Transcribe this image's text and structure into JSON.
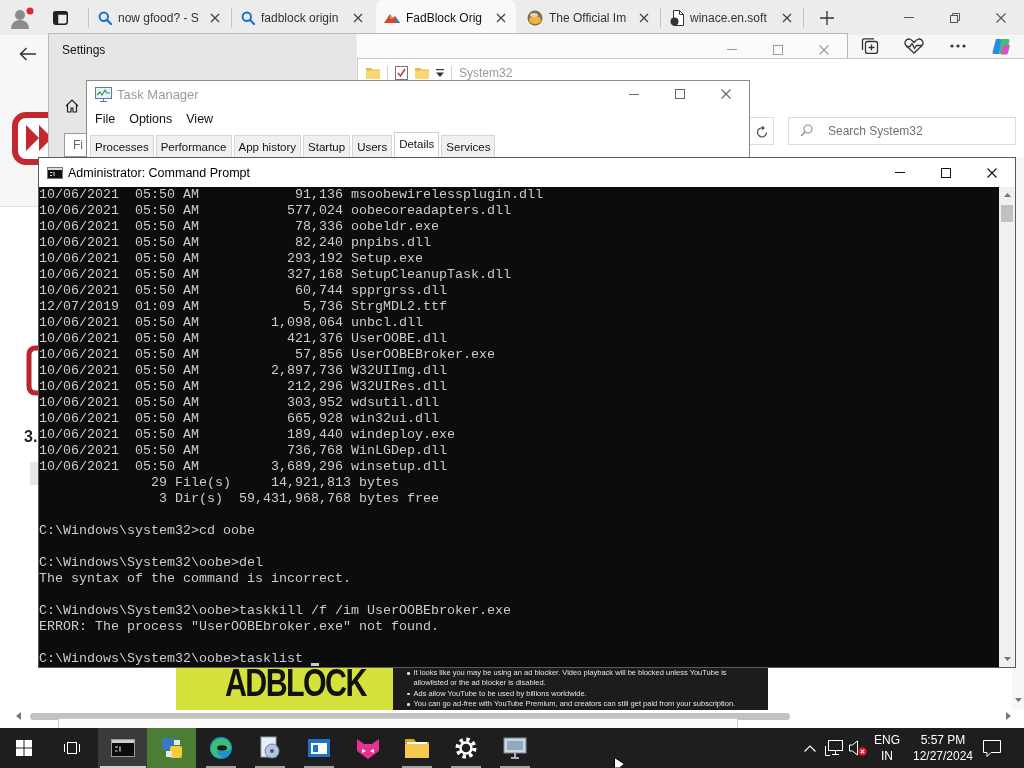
{
  "browser": {
    "profile_alert": true,
    "tabs": [
      {
        "kind": "search",
        "title": "now gfood? - S",
        "selected": false
      },
      {
        "kind": "search",
        "title": "fadblock origin",
        "selected": false
      },
      {
        "kind": "site",
        "title": "FadBlock Orig",
        "selected": true
      },
      {
        "kind": "site-round",
        "title": "The Official Im",
        "selected": false
      },
      {
        "kind": "file",
        "title": "winace.en.soft",
        "selected": false
      }
    ]
  },
  "settings_window": {
    "title": "Settings",
    "search": {
      "placeholder": "Fi"
    }
  },
  "explorer_window": {
    "title": "System32",
    "search": {
      "placeholder": "Search System32"
    }
  },
  "task_manager": {
    "title": "Task Manager",
    "menu": [
      "File",
      "Options",
      "View"
    ],
    "tabs": [
      {
        "label": "Processes",
        "selected": false
      },
      {
        "label": "Performance",
        "selected": false
      },
      {
        "label": "App history",
        "selected": false
      },
      {
        "label": "Startup",
        "selected": false
      },
      {
        "label": "Users",
        "selected": false
      },
      {
        "label": "Details",
        "selected": true
      },
      {
        "label": "Services",
        "selected": false
      }
    ]
  },
  "command_prompt": {
    "title": "Administrator: Command Prompt",
    "blocks": [
      {
        "lines": [
          "10/06/2021  05:50 AM            91,136 msoobewirelessplugin.dll",
          "10/06/2021  05:50 AM           577,024 oobecoreadapters.dll",
          "10/06/2021  05:50 AM            78,336 oobeldr.exe",
          "10/06/2021  05:50 AM            82,240 pnpibs.dll",
          "10/06/2021  05:50 AM           293,192 Setup.exe",
          "10/06/2021  05:50 AM           327,168 SetupCleanupTask.dll",
          "10/06/2021  05:50 AM            60,744 spprgrss.dll",
          "12/07/2019  01:09 AM             5,736 StrgMDL2.ttf",
          "10/06/2021  05:50 AM         1,098,064 unbcl.dll",
          "10/06/2021  05:50 AM           421,376 UserOOBE.dll",
          "10/06/2021  05:50 AM            57,856 UserOOBEBroker.exe",
          "10/06/2021  05:50 AM         2,897,736 W32UIImg.dll",
          "10/06/2021  05:50 AM           212,296 W32UIRes.dll",
          "10/06/2021  05:50 AM           303,952 wdsutil.dll",
          "10/06/2021  05:50 AM           665,928 win32ui.dll",
          "10/06/2021  05:50 AM           189,440 windeploy.exe",
          "10/06/2021  05:50 AM           736,768 WinLGDep.dll",
          "10/06/2021  05:50 AM         3,689,296 winsetup.dll",
          "              29 File(s)     14,921,813 bytes",
          "               3 Dir(s)  59,431,968,768 bytes free"
        ]
      },
      {
        "lines": [
          "C:\\Windows\\system32>cd oobe"
        ]
      },
      {
        "lines": [
          "C:\\Windows\\System32\\oobe>del",
          "The syntax of the command is incorrect."
        ]
      },
      {
        "lines": [
          "C:\\Windows\\System32\\oobe>taskkill /f /im UserOOBEbroker.exe",
          "ERROR: The process \"UserOOBEbroker.exe\" not found."
        ]
      },
      {
        "lines": [
          "C:\\Windows\\System32\\oobe>tasklist"
        ]
      }
    ]
  },
  "page": {
    "step_number": "3.",
    "ad": {
      "headline": "ADBLOCK",
      "bullets": [
        "It looks like you may be using an ad blocker. Video playback will be blocked unless YouTube is allowlisted or the ad blocker is disabled.",
        "Ads allow YouTube to be used by billions worldwide.",
        "You can go ad-free with YouTube Premium, and creators can still get paid from your subscription."
      ]
    }
  },
  "taskbar": {
    "apps": [
      {
        "kind": "terminal",
        "running": true,
        "active": true,
        "attention": false
      },
      {
        "kind": "tiles",
        "running": false,
        "active": false,
        "attention": true
      },
      {
        "kind": "swirl",
        "running": true,
        "active": false,
        "attention": false
      },
      {
        "kind": "disc",
        "running": true,
        "active": false,
        "attention": false
      },
      {
        "kind": "window",
        "running": true,
        "active": false,
        "attention": false
      },
      {
        "kind": "cat",
        "running": false,
        "active": false,
        "attention": false
      },
      {
        "kind": "folder",
        "running": true,
        "active": false,
        "attention": false
      },
      {
        "kind": "gear",
        "running": true,
        "active": false,
        "attention": false
      },
      {
        "kind": "monitor",
        "running": true,
        "active": false,
        "attention": false
      }
    ],
    "tray": {
      "muted": true,
      "language": "ENG",
      "region": "IN",
      "time": "5:57 PM",
      "date": "12/27/2024"
    }
  }
}
